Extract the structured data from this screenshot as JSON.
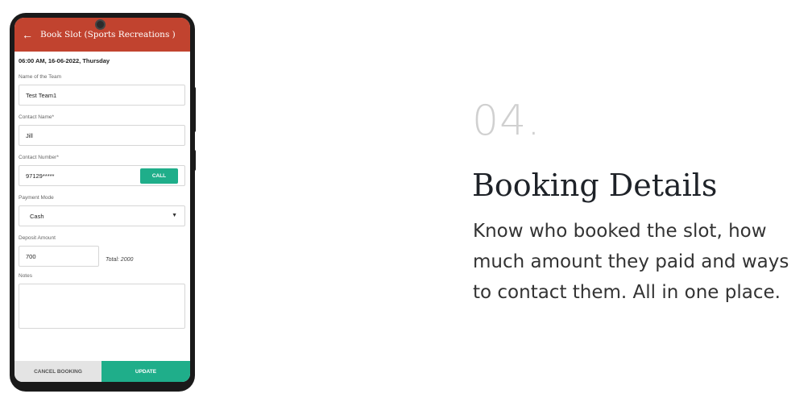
{
  "phone": {
    "appbar": {
      "title": "Book Slot (Sports Recreations )"
    },
    "date_time": "06:00 AM, 16-06-2022, Thursday",
    "team": {
      "label": "Name of the Team",
      "value": "Test Team1"
    },
    "contact_name": {
      "label": "Contact Name*",
      "value": "Jill"
    },
    "contact_number": {
      "label": "Contact Number*",
      "value": "97129*****",
      "call_label": "CALL"
    },
    "payment_mode": {
      "label": "Payment Mode",
      "value": "Cash"
    },
    "deposit": {
      "label": "Deposit Amount",
      "value": "700",
      "total": "Total: 2000"
    },
    "notes": {
      "label": "Notes",
      "value": ""
    },
    "actions": {
      "cancel": "CANCEL BOOKING",
      "update": "UPDATE"
    },
    "colors": {
      "appbar": "#c1432f",
      "accent": "#1fae8a"
    }
  },
  "feature": {
    "number": "04.",
    "title": "Booking Details",
    "description": "Know who booked the slot, how much amount they paid and ways to contact them. All in one place."
  }
}
